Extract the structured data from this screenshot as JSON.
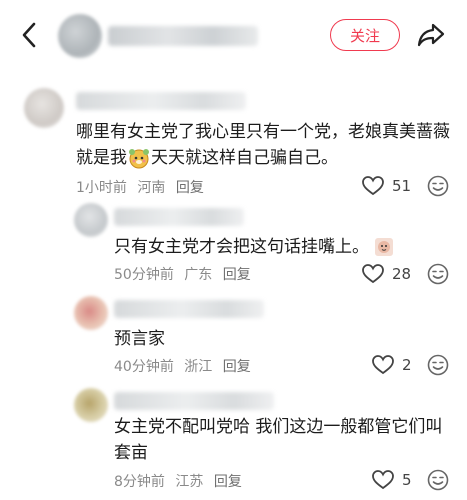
{
  "header": {
    "back_icon": "chevron-left-icon",
    "follow_label": "关注",
    "share_icon": "share-arrow-icon"
  },
  "comments": [
    {
      "text_before": "哪里有女主党了我心里只有一个党，老娘真美蔷薇就是我",
      "text_after": "天天就这样自己骗自己。",
      "time": "1小时前",
      "location": "河南",
      "reply": "回复",
      "likes": "51"
    },
    {
      "text": "只有女主党才会把这句话挂嘴上。",
      "time": "50分钟前",
      "location": "广东",
      "reply": "回复",
      "likes": "28"
    },
    {
      "text": "预言家",
      "time": "40分钟前",
      "location": "浙江",
      "reply": "回复",
      "likes": "2"
    },
    {
      "text": "女主党不配叫党哈 我们这边一般都管它们叫套亩",
      "time": "8分钟前",
      "location": "江苏",
      "reply": "回复",
      "likes": "5"
    }
  ],
  "colors": {
    "accent": "#f03a4f",
    "meta": "#8a8a8a"
  }
}
